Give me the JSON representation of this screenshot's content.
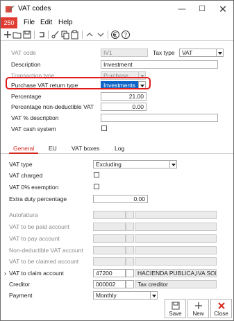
{
  "window": {
    "title": "VAT codes"
  },
  "menubar": {
    "company_badge": "250",
    "items": [
      "File",
      "Edit",
      "Help"
    ]
  },
  "form": {
    "vat_code": {
      "label": "VAT code",
      "value": "IV1"
    },
    "tax_type": {
      "label": "Tax type",
      "value": "VAT"
    },
    "description": {
      "label": "Description",
      "value": "Investment"
    },
    "transaction_type": {
      "label": "Transaction type",
      "value": "Purchase"
    },
    "purchase_vat_return_type": {
      "label": "Purchase VAT return type",
      "value": "Investments"
    },
    "percentage": {
      "label": "Percentage",
      "value": "21.00"
    },
    "percentage_non_deductible": {
      "label": "Percentage non-deductible VAT",
      "value": "0.00"
    },
    "vat_percent_description": {
      "label": "VAT % description",
      "value": ""
    },
    "vat_cash_system": {
      "label": "VAT cash system",
      "checked": false
    }
  },
  "tabs": {
    "items": [
      "General",
      "EU",
      "VAT boxes",
      "Log"
    ],
    "active": "General"
  },
  "general": {
    "vat_type": {
      "label": "VAT type",
      "value": "Excluding"
    },
    "vat_charged": {
      "label": "VAT charged",
      "checked": false
    },
    "vat_0_exemption": {
      "label": "VAT 0% exemption",
      "checked": false
    },
    "extra_duty_percentage": {
      "label": "Extra duty percentage",
      "value": "0.00"
    },
    "autofattura": {
      "label": "Autofattura"
    },
    "vat_to_be_paid_account": {
      "label": "VAT to be paid account"
    },
    "vat_to_pay_account": {
      "label": "VAT to pay account"
    },
    "non_deductible_vat_account": {
      "label": "Non-deductible VAT account"
    },
    "vat_to_be_claimed_account": {
      "label": "VAT to be claimed account"
    },
    "vat_to_claim_account": {
      "label": "VAT to claim account",
      "code": "47200",
      "description": "HACIENDA PUBLICA,IVA SOPORTA"
    },
    "creditor": {
      "label": "Creditor",
      "code": "000002",
      "description": "Tax creditor"
    },
    "payment": {
      "label": "Payment",
      "value": "Monthly"
    }
  },
  "buttons": {
    "save": "Save",
    "new": "New",
    "close": "Close"
  },
  "colors": {
    "accent_red": "#d4261b",
    "selection_blue": "#0f66c7",
    "highlight_box": "#e31a1a"
  }
}
